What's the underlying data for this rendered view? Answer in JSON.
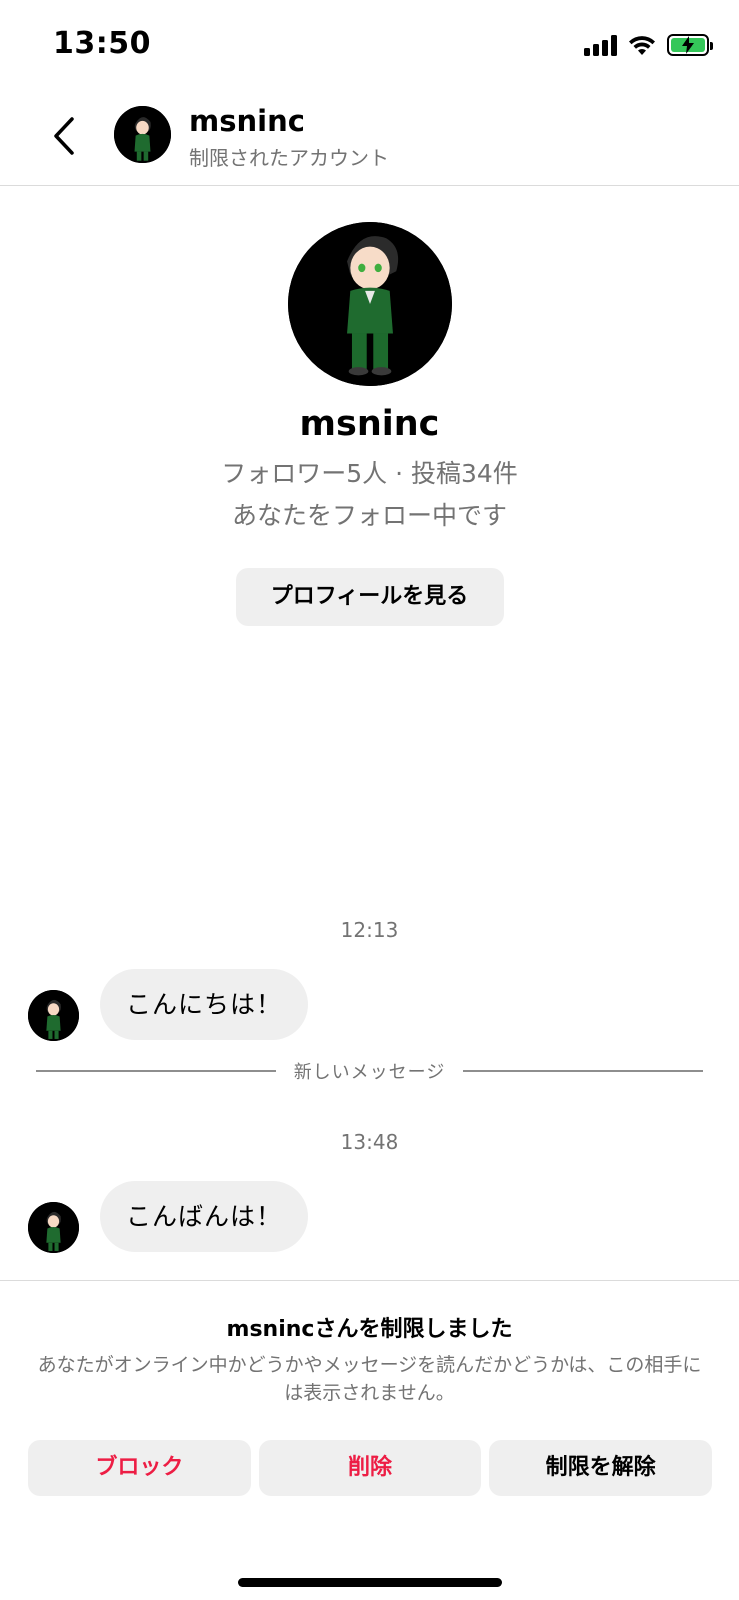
{
  "status_bar": {
    "time": "13:50",
    "icons": [
      "signal-icon",
      "wifi-icon",
      "battery-charging-icon"
    ],
    "battery_color": "#34c759"
  },
  "header": {
    "name": "msninc",
    "subtitle": "制限されたアカウント",
    "back_icon": "chevron-left-icon"
  },
  "profile": {
    "name": "msninc",
    "stats": "フォロワー5人 · 投稿34件",
    "follow_status": "あなたをフォロー中です",
    "view_profile_label": "プロフィールを見る"
  },
  "messages": [
    {
      "timestamp": "12:13",
      "text": "こんにちは！"
    },
    {
      "timestamp": "13:48",
      "text": "こんばんは！"
    }
  ],
  "divider_label": "新しいメッセージ",
  "notice": {
    "title": "msnincさんを制限しました",
    "description": "あなたがオンライン中かどうかやメッセージを読んだかどうかは、この相手には表示されません。"
  },
  "actions": {
    "block_label": "ブロック",
    "delete_label": "削除",
    "unrestrict_label": "制限を解除"
  },
  "colors": {
    "danger": "#ed1d44",
    "bubble": "#efefef",
    "secondary_text": "#737373"
  }
}
